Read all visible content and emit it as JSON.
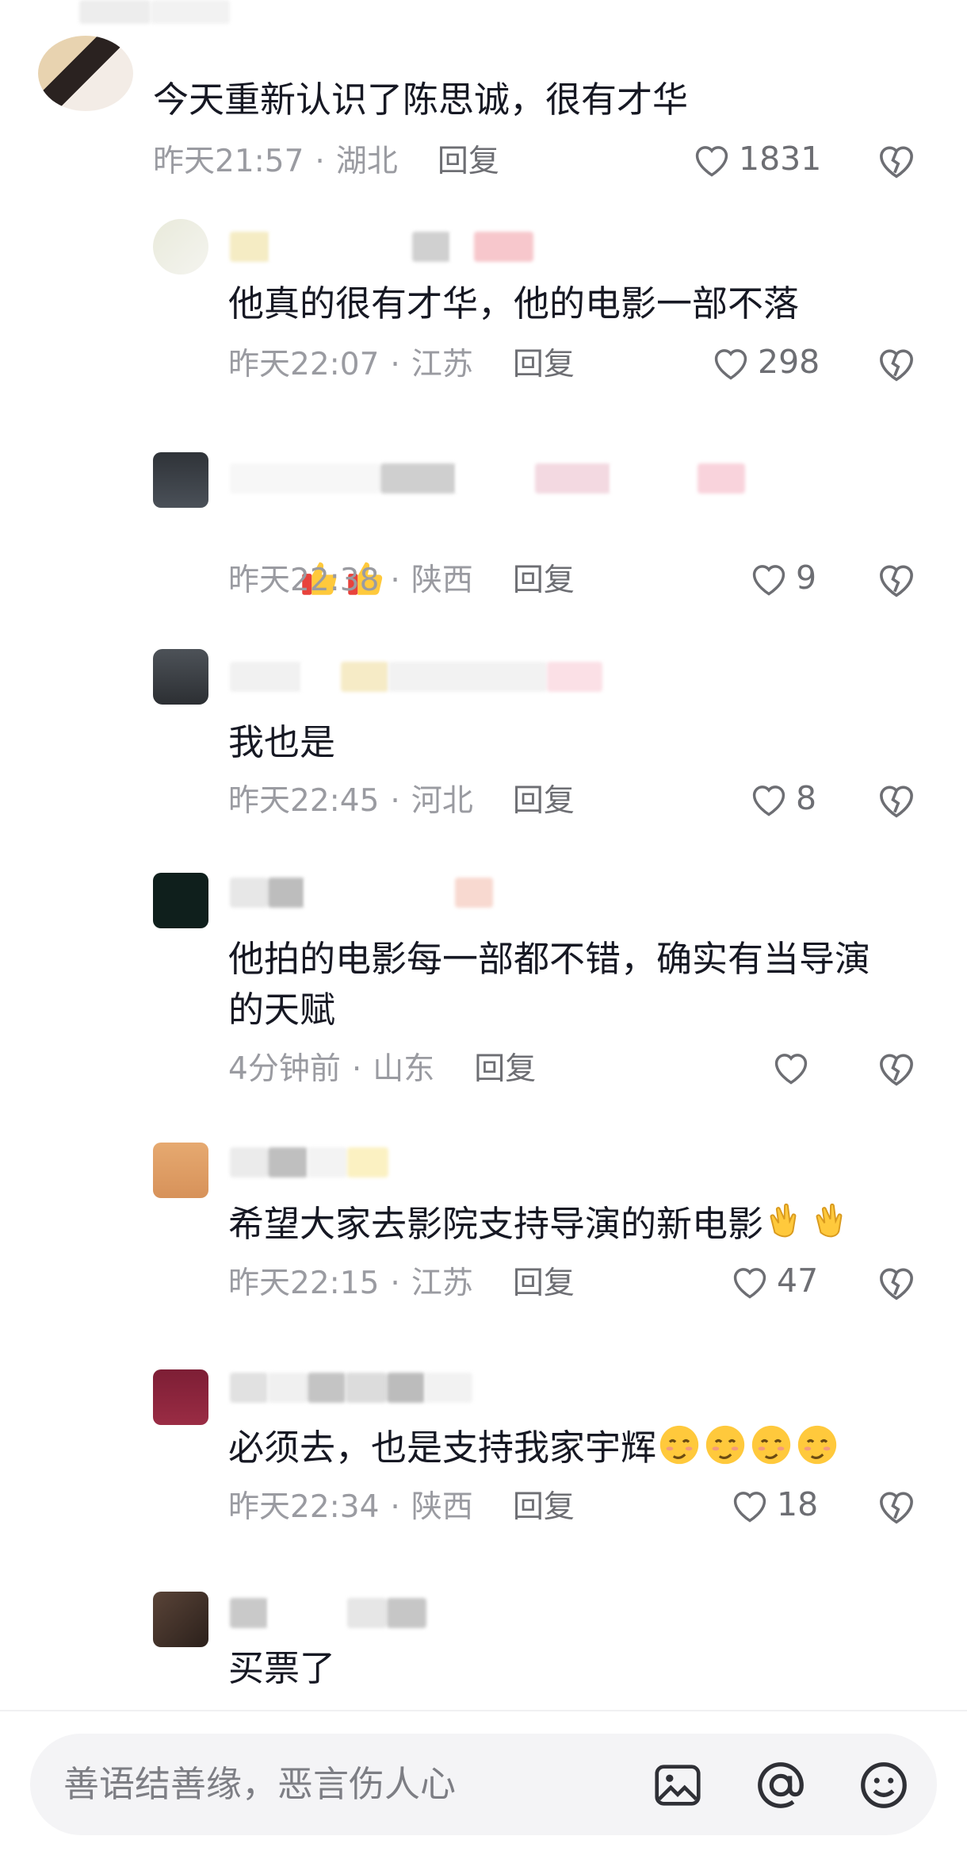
{
  "comments": [
    {
      "text": "今天重新认识了陈思诚，很有才华",
      "time": "昨天21:57",
      "location": "湖北",
      "reply": "回复",
      "likes": "1831"
    },
    {
      "text": "他真的很有才华，他的电影一部不落",
      "time": "昨天22:07",
      "location": "江苏",
      "reply": "回复",
      "likes": "298"
    },
    {
      "text": "",
      "time": "昨天22:38",
      "location": "陕西",
      "reply": "回复",
      "likes": "9"
    },
    {
      "text": "我也是",
      "time": "昨天22:45",
      "location": "河北",
      "reply": "回复",
      "likes": "8"
    },
    {
      "text_line1": "他拍的电影每一部都不错，确实有当导演",
      "text_line2": "的天赋",
      "time": "4分钟前",
      "location": "山东",
      "reply": "回复",
      "likes": ""
    },
    {
      "text": "希望大家去影院支持导演的新电影",
      "time": "昨天22:15",
      "location": "江苏",
      "reply": "回复",
      "likes": "47"
    },
    {
      "text": "必须去，也是支持我家宇辉",
      "time": "昨天22:34",
      "location": "陕西",
      "reply": "回复",
      "likes": "18"
    },
    {
      "text": "买票了"
    }
  ],
  "separator": "·",
  "input": {
    "placeholder": "善语结善缘，恶言伤人心"
  },
  "icons": [
    "heart-icon",
    "broken-heart-icon",
    "thumbs-up-emoji",
    "clapping-emoji",
    "shy-emoji",
    "image-icon",
    "at-icon",
    "smile-icon"
  ],
  "watermark": "",
  "colors": {
    "text": "#161823",
    "meta": "#9a9ba1",
    "input_bg": "#f4f4f6"
  }
}
